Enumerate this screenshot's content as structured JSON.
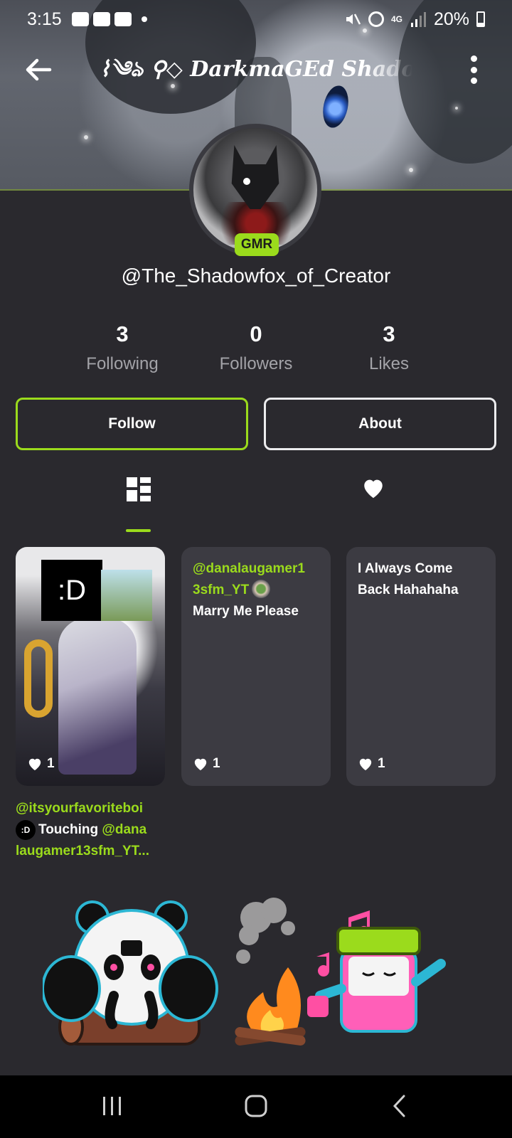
{
  "status_bar": {
    "time": "3:15",
    "network": "4G",
    "battery": "20%"
  },
  "header": {
    "title": "⌇༄ঌ ⚲◇ DarkmaGEd Shadow"
  },
  "profile": {
    "badge": "GMR",
    "handle": "@The_Shadowfox_of_Creator"
  },
  "stats": [
    {
      "value": "3",
      "label": "Following"
    },
    {
      "value": "0",
      "label": "Followers"
    },
    {
      "value": "3",
      "label": "Likes"
    }
  ],
  "actions": {
    "follow": "Follow",
    "about": "About"
  },
  "tabs": {
    "active": "posts",
    "items": [
      {
        "id": "posts",
        "icon": "grid-icon"
      },
      {
        "id": "likes",
        "icon": "heart-icon"
      }
    ]
  },
  "posts": [
    {
      "type": "image",
      "overlay_text": ":D",
      "likes": "1",
      "caption": {
        "user": "@itsyourfavoriteboi",
        "badge": ":D",
        "text": "Touching",
        "mention_part1": "@dana",
        "mention_part2": "laugamer13sfm_YT..."
      }
    },
    {
      "type": "text",
      "mention_line1": "@danalaugamer1",
      "mention_line2": "3sfm_YT",
      "text": "Marry Me Please",
      "likes": "1"
    },
    {
      "type": "text",
      "text_line1": "I Always Come",
      "text_line2": "Back Hahahaha",
      "likes": "1"
    }
  ],
  "colors": {
    "accent": "#9bdb1c",
    "background": "#2a292e",
    "card": "#3c3b42",
    "muted_text": "#a3a3a8"
  }
}
